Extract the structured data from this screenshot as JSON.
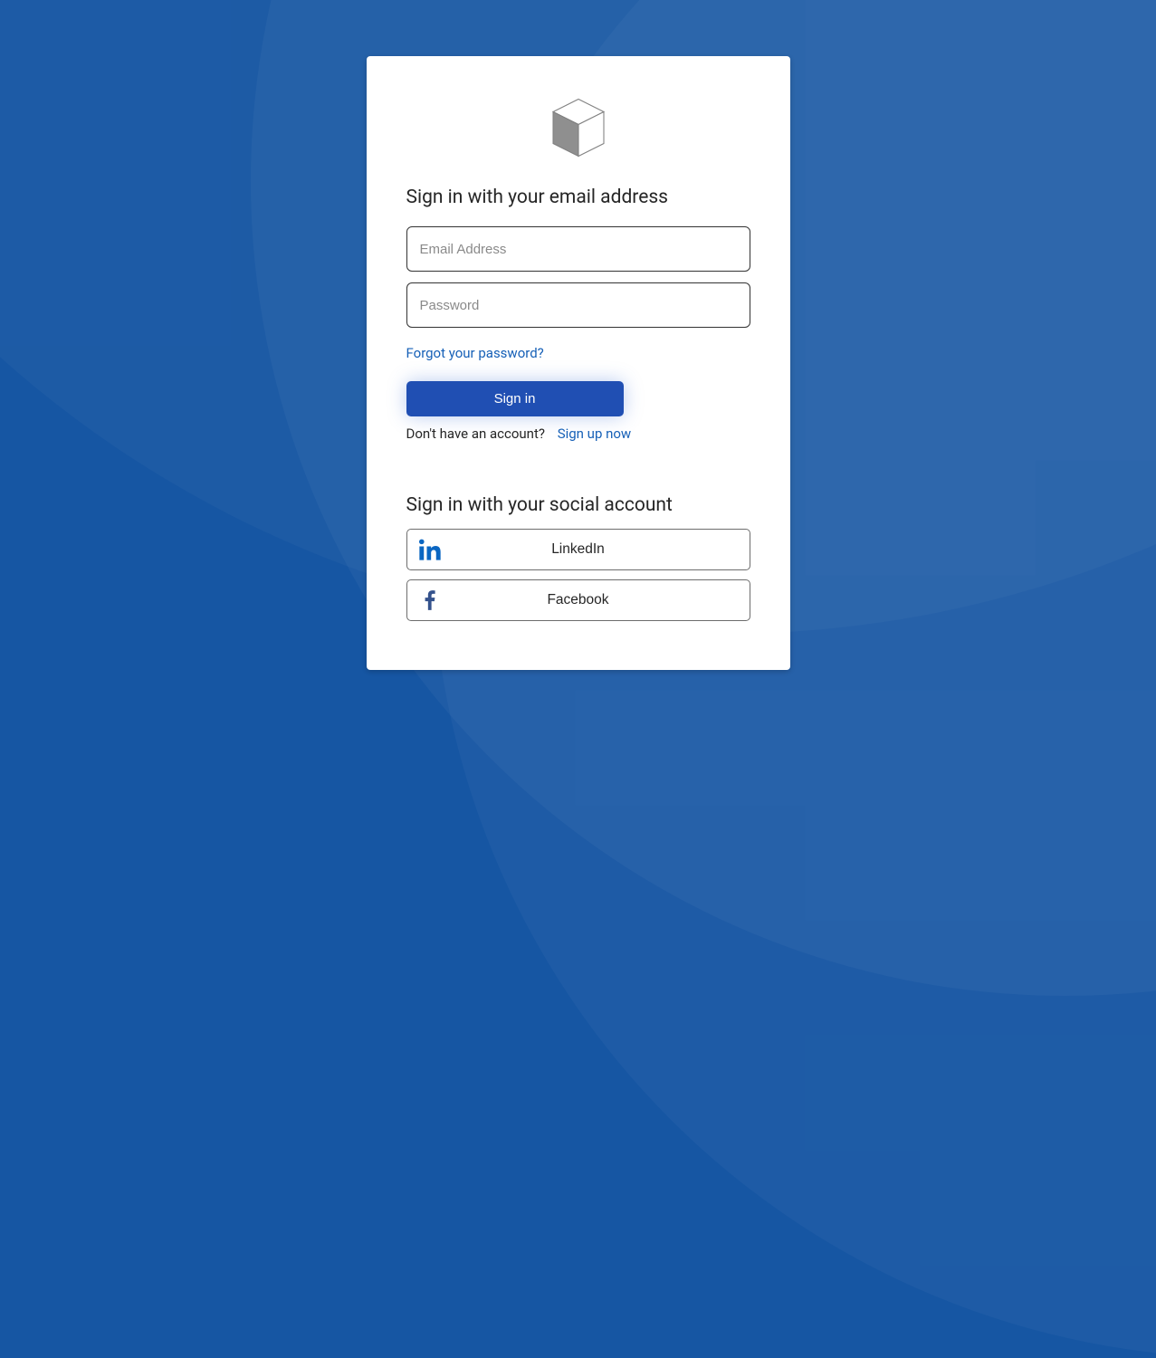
{
  "header": {
    "logo_alt": "cube-logo"
  },
  "signin": {
    "heading": "Sign in with your email address",
    "email_placeholder": "Email Address",
    "password_placeholder": "Password",
    "forgot_label": "Forgot your password?",
    "submit_label": "Sign in",
    "no_account_text": "Don't have an account?",
    "signup_label": "Sign up now"
  },
  "social": {
    "heading": "Sign in with your social account",
    "providers": {
      "linkedin": {
        "label": "LinkedIn"
      },
      "facebook": {
        "label": "Facebook"
      }
    }
  }
}
